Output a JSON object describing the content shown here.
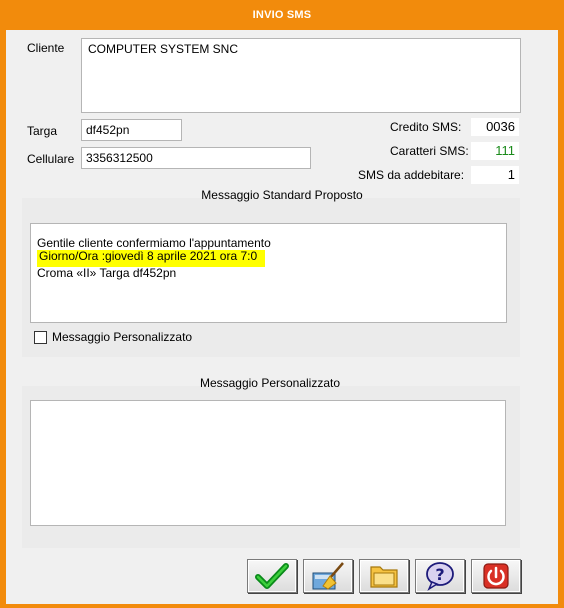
{
  "window": {
    "title": "INVIO SMS"
  },
  "cliente": {
    "label": "Cliente",
    "value": "COMPUTER SYSTEM SNC"
  },
  "targa": {
    "label": "Targa",
    "value": "df452pn"
  },
  "cellulare": {
    "label": "Cellulare",
    "value": "3356312500"
  },
  "credito": {
    "label": "Credito SMS:",
    "value": "0036"
  },
  "caratteri": {
    "label": "Caratteri SMS:",
    "value": "111",
    "color": "#1a8a1a"
  },
  "addebitare": {
    "label": "SMS da addebitare:",
    "value": "1"
  },
  "standard": {
    "title": "Messaggio Standard Proposto",
    "text_before": "Gentile cliente confermiamo l'appuntamento ",
    "text_highlight": "Giorno/Ora :giovedì 8 aprile 2021 ora 7:0",
    "text_line2": "Croma «II» Targa df452pn",
    "highlight_color": "#ffff00"
  },
  "personalizzato_check": {
    "label": "Messaggio  Personalizzato",
    "checked": false
  },
  "personalizzato": {
    "title": "Messaggio  Personalizzato",
    "value": ""
  },
  "toolbar": {
    "buttons": [
      {
        "name": "confirm",
        "icon": "check-icon"
      },
      {
        "name": "clear",
        "icon": "broom-icon"
      },
      {
        "name": "folder",
        "icon": "folder-icon"
      },
      {
        "name": "help",
        "icon": "help-bubble-icon"
      },
      {
        "name": "exit",
        "icon": "power-icon"
      }
    ]
  },
  "colors": {
    "title_bar": "#f28b0c",
    "background": "#f0f0f0"
  }
}
